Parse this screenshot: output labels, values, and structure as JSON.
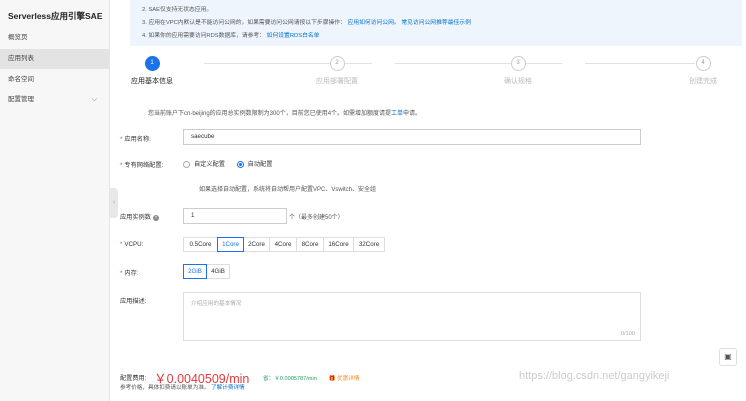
{
  "sidebar": {
    "title": "Serverless应用引擎SAE",
    "items": [
      {
        "label": "概览页"
      },
      {
        "label": "应用列表"
      },
      {
        "label": "命名空间"
      },
      {
        "label": "配置管理"
      }
    ]
  },
  "notice": {
    "line2": "2. SAE仅支持无状态应用。",
    "line3_text": "3. 应用在VPC内默认是不能访问公网的，如果需要访问公网请按以下步骤操作：",
    "line3_link1": "应用如何访问公网。",
    "line3_link2": "常见访问公网推荐最佳示例",
    "line4_text": "4. 如果你的应用需要访问RDS数据库，请参考：",
    "line4_link": "如何设置RDS白名单"
  },
  "steps": [
    {
      "num": "1",
      "label": "应用基本信息"
    },
    {
      "num": "2",
      "label": "应用部署配置"
    },
    {
      "num": "3",
      "label": "确认规格"
    },
    {
      "num": "4",
      "label": "创建完成"
    }
  ],
  "quota": {
    "text_before": "您当前账户下cn-beijing的应用总实例数限制为300个，目前您已使用4个。如需增加额度请提",
    "link": "工单",
    "text_after": "申请。"
  },
  "form": {
    "app_name_label": "应用名称:",
    "app_name_value": "saecube",
    "network_label": "专有网络配置:",
    "network_options": [
      "自定义配置",
      "自动配置"
    ],
    "network_hint": "如果选择自动配置，系统将自动帮用户配置VPC、Vswitch、安全组",
    "instances_label": "应用实例数",
    "instances_value": "1",
    "instances_unit": "个（最多创建50个）",
    "vcpu_label": "VCPU:",
    "vcpu_options": [
      "0.5Core",
      "1Core",
      "2Core",
      "4Core",
      "8Core",
      "16Core",
      "32Core"
    ],
    "vcpu_selected": "1Core",
    "memory_label": "内存:",
    "memory_options": [
      "2GiB",
      "4GiB"
    ],
    "memory_selected": "2GiB",
    "desc_label": "应用描述:",
    "desc_placeholder": "介绍应用的基本情况",
    "desc_counter": "0/100"
  },
  "fee": {
    "label": "配置费用:",
    "price": "￥0.0040509/min",
    "save_text": "省：￥0.0005787/min",
    "detail_link": "优惠详情",
    "ref_text": "参考价格，具体扣费请以账单为准。",
    "ref_link": "了解计费详情"
  },
  "watermark": "https://blog.csdn.net/gangyikeji",
  "colors": {
    "accent": "#1a73e8",
    "price": "#e4393c",
    "notice_bg": "#eef5fd",
    "link": "#0070cc"
  }
}
